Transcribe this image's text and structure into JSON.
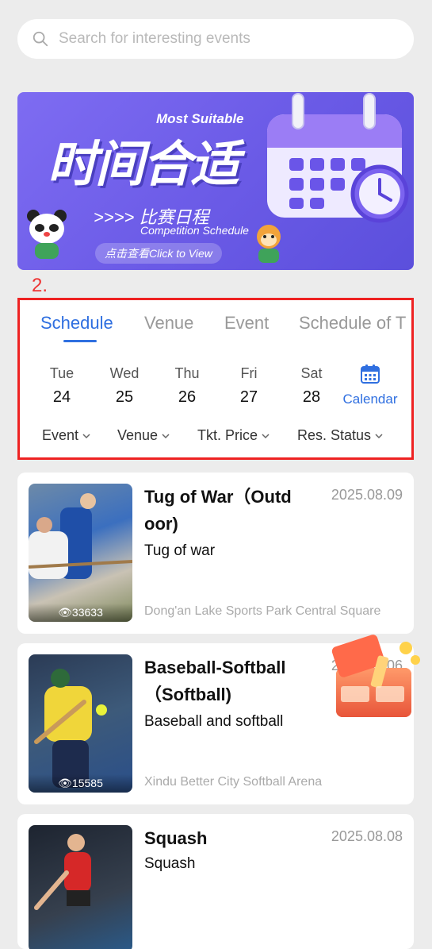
{
  "search": {
    "placeholder": "Search for interesting events"
  },
  "banner": {
    "title_cn": "时间合适",
    "most_suitable": "Most Suitable",
    "subtitle_cn": ">>>> 比赛日程",
    "subtitle_en": "Competition Schedule",
    "cta": "点击查看Click to View"
  },
  "section_number": "2.",
  "tabs": [
    {
      "label": "Schedule",
      "active": true
    },
    {
      "label": "Venue",
      "active": false
    },
    {
      "label": "Event",
      "active": false
    },
    {
      "label": "Schedule of T",
      "active": false
    }
  ],
  "days": [
    {
      "dow": "Tue",
      "num": "24"
    },
    {
      "dow": "Wed",
      "num": "25"
    },
    {
      "dow": "Thu",
      "num": "26"
    },
    {
      "dow": "Fri",
      "num": "27"
    },
    {
      "dow": "Sat",
      "num": "28"
    }
  ],
  "calendar_label": "Calendar",
  "filters": [
    "Event",
    "Venue",
    "Tkt. Price",
    "Res. Status"
  ],
  "events": [
    {
      "title_l1": "Tug of War（Outd",
      "title_l2": "oor)",
      "date": "2025.08.09",
      "subtitle": "Tug of war",
      "venue": "Dong'an Lake Sports Park Central Square",
      "views": "33633"
    },
    {
      "title_l1": "Baseball-Softball",
      "title_l2": "（Softball)",
      "date": "2025.08.06",
      "subtitle": "Baseball and softball",
      "venue": "Xindu Better City Softball Arena",
      "views": "15585"
    },
    {
      "title_l1": "Squash",
      "title_l2": "",
      "date": "2025.08.08",
      "subtitle": "Squash",
      "venue": "",
      "views": ""
    }
  ],
  "colors": {
    "accent": "#2f6fe0",
    "highlight_border": "#ee2222",
    "banner": "#6a5ae6"
  }
}
